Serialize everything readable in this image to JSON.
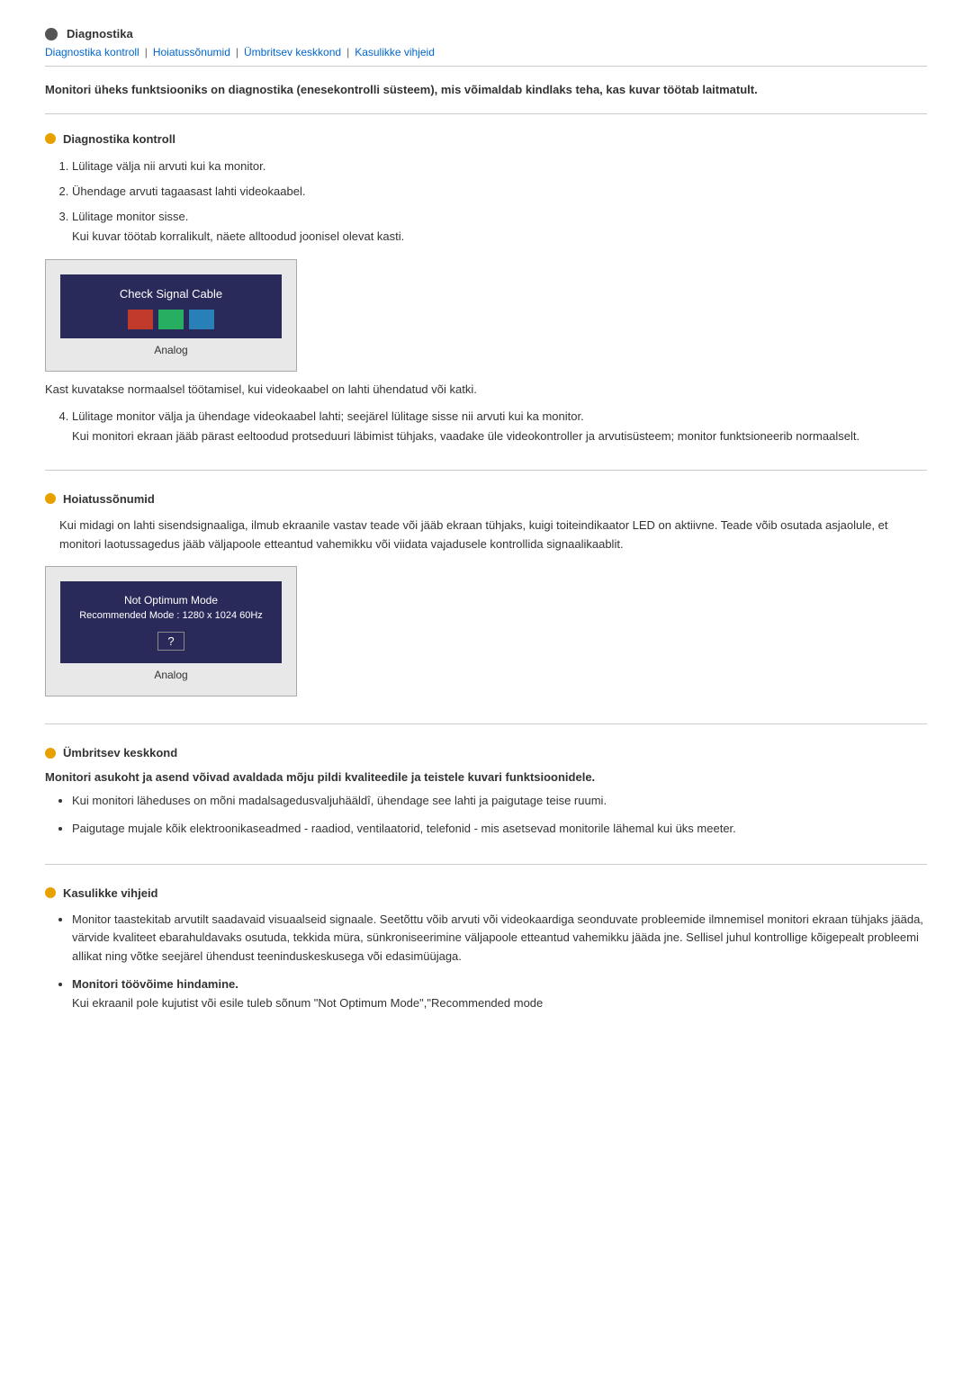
{
  "header": {
    "icon_label": "circle-icon",
    "title": "Diagnostika"
  },
  "nav": {
    "links": [
      "Diagnostika kontroll",
      "Hoiatussõnumid",
      "Ümbritsev keskkond",
      "Kasulikke vihjeid"
    ],
    "separator": "|"
  },
  "intro": "Monitori üheks funktsiooniks on diagnostika (enesekontrolli süsteem), mis võimaldab kindlaks teha, kas kuvar töötab laitmatult.",
  "section1": {
    "title": "Diagnostika kontroll",
    "steps": [
      "Lülitage välja nii arvuti kui ka monitor.",
      "Ühendage arvuti tagaasast lahti videokaabel.",
      {
        "main": "Lülitage monitor sisse.",
        "sub": "Kui kuvar töötab korralikult, näete alltoodud joonisel olevat kasti."
      }
    ],
    "monitor_box": {
      "screen_title": "Check Signal Cable",
      "colors": [
        "#c0392b",
        "#27ae60",
        "#2980b9"
      ],
      "label": "Analog"
    },
    "note": "Kast kuvatakse normaalsel töötamisel, kui videokaabel on lahti ühendatud või katki.",
    "step4": {
      "main": "Lülitage monitor välja ja ühendage videokaabel lahti; seejärel lülitage sisse nii arvuti kui ka monitor.",
      "sub": "Kui monitori ekraan jääb pärast eeltoodud protseduuri läbimist tühjaks, vaadake üle videokontroller ja arvutisüsteem; monitor funktsioneerib normaalselt."
    }
  },
  "section2": {
    "title": "Hoiatussõnumid",
    "text": "Kui midagi on lahti sisendsignaaliga, ilmub ekraanile vastav teade või jääb ekraan tühjaks, kuigi toiteindikaator LED on aktiivne. Teade võib osutada asjaolule, et monitori laotussagedus jääb väljapoole etteantud vahemikku või viidata vajadusele kontrollida signaalikaablit.",
    "monitor_box": {
      "screen_title": "Not Optimum Mode",
      "screen_sub": "Recommended Mode : 1280 x 1024  60Hz",
      "question": "?",
      "label": "Analog"
    }
  },
  "section3": {
    "title": "Ümbritsev keskkond",
    "bold": "Monitori asukoht ja asend võivad avaldada mõju pildi kvaliteedile ja teistele kuvari funktsioonidele.",
    "bullets": [
      "Kui monitori läheduses on mõni madalsagedusvaljuhääldî, ühendage see lahti ja paigutage teise ruumi.",
      "Paigutage mujale kõik elektroonikaseadmed - raadiod, ventilaatorid, telefonid - mis asetsevad monitorile lähemal kui üks meeter."
    ]
  },
  "section4": {
    "title": "Kasulikke vihjeid",
    "bullets": [
      "Monitor taastekitab arvutilt saadavaid visuaalseid signaale. Seetõttu võib arvuti või videokaardiga seonduvate probleemide ilmnemisel monitori ekraan tühjaks jääda, värvide kvaliteet ebarahuldavaks osutuda, tekkida müra, sünkroniseerimine väljapoole etteantud vahemikku jääda jne. Sellisel juhul kontrollige kõigepealt probleemi allikat ning võtke seejärel ühendust teeninduskeskusega või edasimüüjaga.",
      {
        "bold": "Monitori töövõime hindamine.",
        "normal": "Kui ekraanil pole kujutist või esile tuleb sõnum \"Not Optimum Mode\",\"Recommended mode"
      }
    ]
  }
}
